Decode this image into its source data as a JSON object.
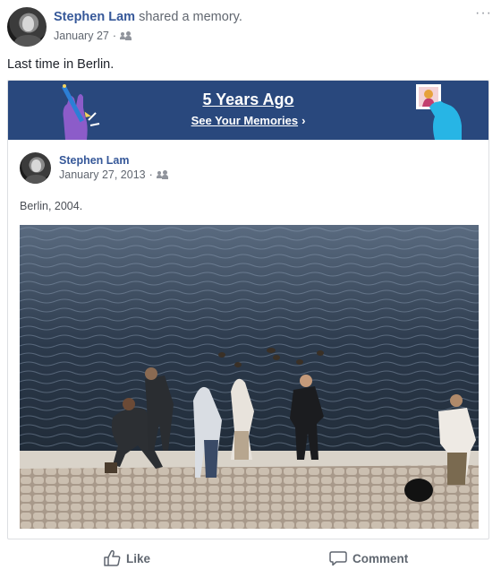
{
  "post": {
    "author": "Stephen Lam",
    "action_text": "shared a memory.",
    "date": "January 27",
    "separator": "·",
    "text": "Last time in Berlin."
  },
  "memory": {
    "banner_title": "5 Years Ago",
    "banner_link": "See Your Memories",
    "banner_link_chevron": "›",
    "author": "Stephen Lam",
    "date": "January 27, 2013",
    "separator": "·",
    "caption": "Berlin, 2004."
  },
  "actions": {
    "like_label": "Like",
    "comment_label": "Comment"
  },
  "more_icon": "···",
  "colors": {
    "banner": "#29487d",
    "author_link": "#365899",
    "secondary_text": "#616770"
  }
}
